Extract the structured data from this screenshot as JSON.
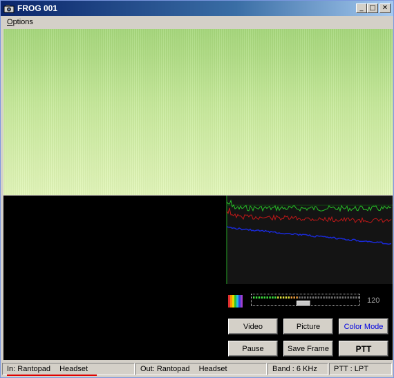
{
  "window": {
    "title": "FROG 001",
    "minimize": "_",
    "maximize": "□",
    "close": "✕"
  },
  "menu": {
    "options_label": "Options"
  },
  "level": {
    "value": "120",
    "meter_fraction": 0.42,
    "slider_fraction": 0.48
  },
  "buttons": {
    "video": "Video",
    "picture": "Picture",
    "color_mode": "Color Mode",
    "pause": "Pause",
    "save_frame": "Save Frame",
    "ptt": "PTT"
  },
  "status": {
    "input_prefix": "In: Rantopad",
    "input_device": "Headset",
    "output_prefix": "Out: Rantopad",
    "output_device": "Headset",
    "band": "Band :  6 KHz",
    "ptt": "PTT : LPT"
  },
  "colors": {
    "accent_blue": "#0000e0",
    "status_underline": "#e00000"
  }
}
